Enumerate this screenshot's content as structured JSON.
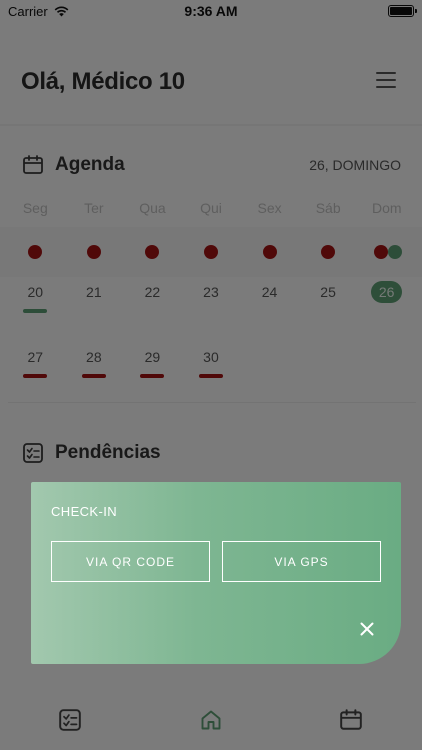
{
  "status_bar": {
    "carrier": "Carrier",
    "time": "9:36 AM"
  },
  "header": {
    "greeting": "Olá, Médico 10"
  },
  "agenda": {
    "title": "Agenda",
    "current_date": "26, DOMINGO",
    "weekdays": [
      "Seg",
      "Ter",
      "Qua",
      "Qui",
      "Sex",
      "Sáb",
      "Dom"
    ],
    "week1": [
      "20",
      "21",
      "22",
      "23",
      "24",
      "25",
      "26"
    ],
    "week2": [
      "27",
      "28",
      "29",
      "30"
    ],
    "selected_day": "26"
  },
  "pendencias": {
    "title": "Pendências"
  },
  "checkin": {
    "label": "CHECK-IN",
    "qr_button": "VIA QR CODE",
    "gps_button": "VIA GPS"
  },
  "colors": {
    "accent_green": "#5d9c73",
    "alert_red": "#a11212",
    "card_gradient_start": "#a2c8ae",
    "card_gradient_end": "#6aac83"
  },
  "icons": {
    "wifi": "wifi-icon",
    "battery": "battery-icon",
    "menu": "menu-icon",
    "calendar": "calendar-icon",
    "checklist": "checklist-icon",
    "close": "close-icon",
    "home": "home-icon"
  }
}
